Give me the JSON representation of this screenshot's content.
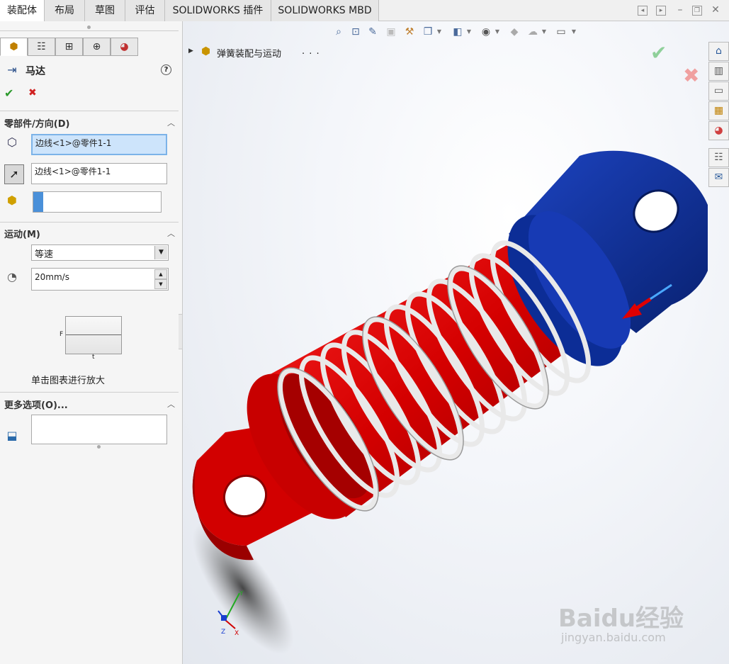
{
  "tabs": [
    {
      "label": "装配体",
      "active": true
    },
    {
      "label": "布局",
      "active": false
    },
    {
      "label": "草图",
      "active": false
    },
    {
      "label": "评估",
      "active": false
    },
    {
      "label": "SOLIDWORKS 插件",
      "active": false
    },
    {
      "label": "SOLIDWORKS MBD",
      "active": false
    }
  ],
  "panel": {
    "feature_name": "马达",
    "help_glyph": "?",
    "ok_glyph": "✔",
    "cancel_glyph": "✖",
    "section_component": "零部件/方向(D)",
    "component_field": "边线<1>@零件1-1",
    "direction_field": "边线<1>@零件1-1",
    "section_motion": "运动(M)",
    "motion_type": "等速",
    "speed": "20mm/s",
    "graph_label_f": "F",
    "graph_label_t": "t",
    "graph_hint": "单击图表进行放大",
    "section_more": "更多选项(O)...",
    "accent_color": "#4a90d9"
  },
  "tree": {
    "assembly_name": "弹簧装配与运动",
    "ellipsis": ". . ."
  },
  "watermark": {
    "brand": "Baidu经验",
    "url": "jingyan.baidu.com"
  },
  "triad": {
    "x": "X",
    "y": "Y",
    "z": "Z"
  },
  "colors": {
    "red_part": "#d40000",
    "blue_part": "#0a2f9e",
    "spring": "#e8e8e8"
  }
}
